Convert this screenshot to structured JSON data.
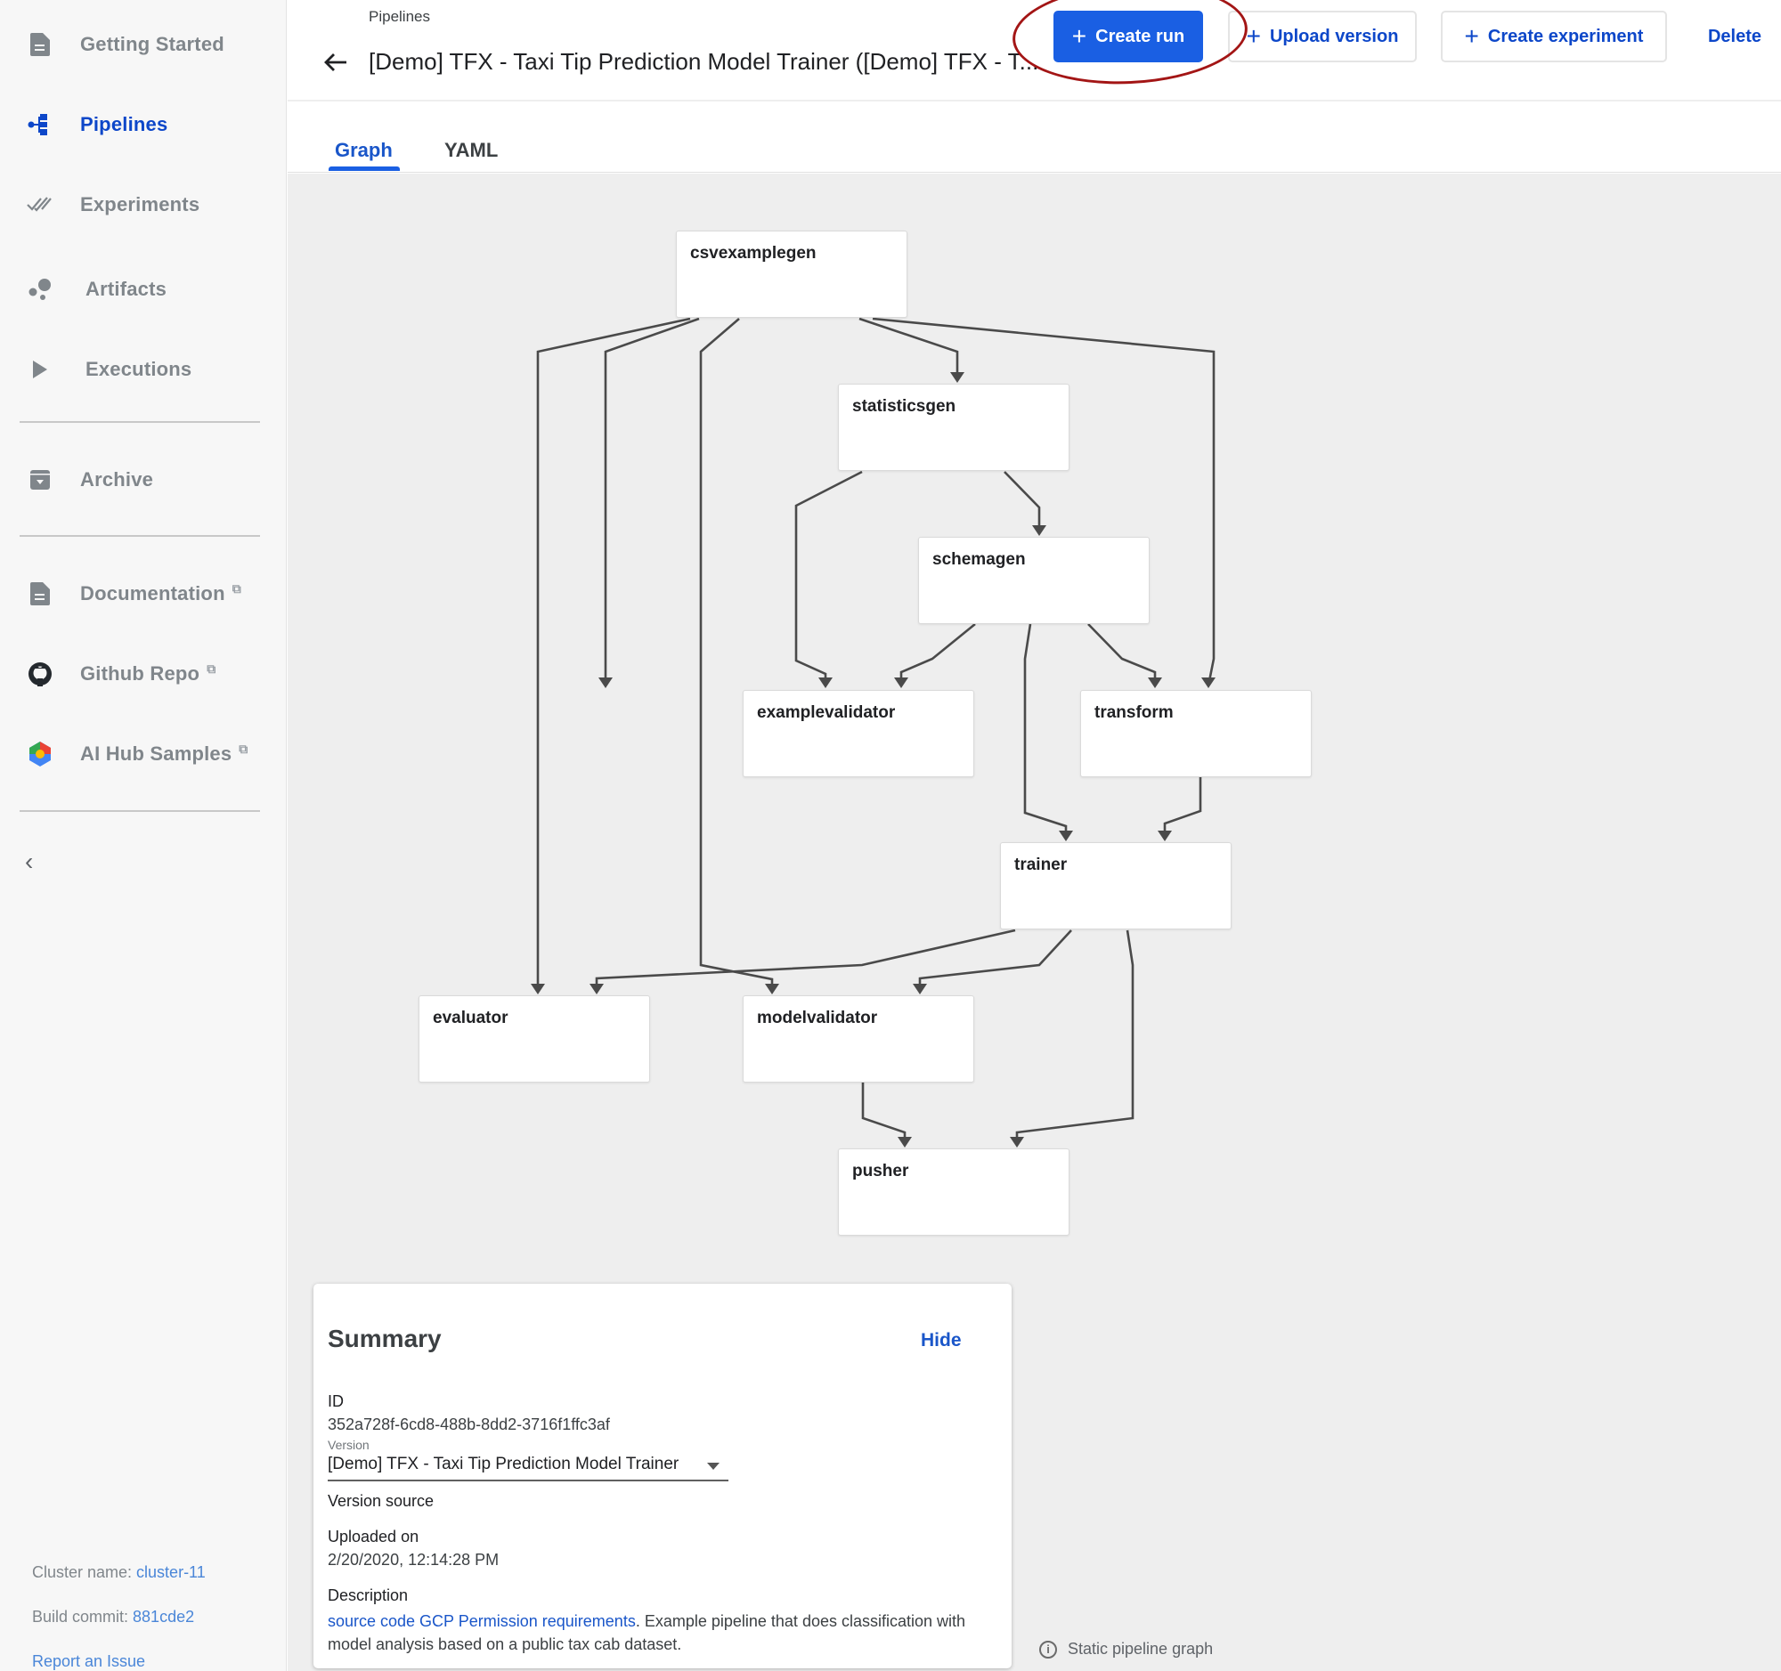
{
  "sidebar": {
    "items": [
      {
        "label": "Getting Started",
        "icon": "document-icon",
        "active": false,
        "external": false
      },
      {
        "label": "Pipelines",
        "icon": "pipeline-icon",
        "active": true,
        "external": false
      },
      {
        "label": "Experiments",
        "icon": "double-check-icon",
        "active": false,
        "external": false
      },
      {
        "label": "Artifacts",
        "icon": "bubbles-icon",
        "active": false,
        "external": false
      },
      {
        "label": "Executions",
        "icon": "play-icon",
        "active": false,
        "external": false
      },
      {
        "label": "Archive",
        "icon": "archive-icon",
        "active": false,
        "external": false
      },
      {
        "label": "Documentation",
        "icon": "document-icon",
        "active": false,
        "external": true
      },
      {
        "label": "Github Repo",
        "icon": "github-icon",
        "active": false,
        "external": true
      },
      {
        "label": "AI Hub Samples",
        "icon": "ai-hub-icon",
        "active": false,
        "external": true
      }
    ],
    "external_glyph": "⧉",
    "collapse_glyph": "‹",
    "footer": {
      "cluster_label": "Cluster name: ",
      "cluster_value": "cluster-11",
      "commit_label": "Build commit: ",
      "commit_value": "881cde2",
      "report_issue": "Report an Issue"
    }
  },
  "header": {
    "breadcrumb": "Pipelines",
    "title": "[Demo] TFX - Taxi Tip Prediction Model Trainer ([Demo] TFX - T...",
    "buttons": {
      "create_run": "Create run",
      "upload_version": "Upload version",
      "create_experiment": "Create experiment",
      "delete": "Delete"
    },
    "plus_glyph": "+"
  },
  "tabs": [
    {
      "label": "Graph",
      "active": true
    },
    {
      "label": "YAML",
      "active": false
    }
  ],
  "graph": {
    "nodes": [
      {
        "id": "csvexamplegen",
        "label": "csvexamplegen"
      },
      {
        "id": "statisticsgen",
        "label": "statisticsgen"
      },
      {
        "id": "schemagen",
        "label": "schemagen"
      },
      {
        "id": "examplevalidator",
        "label": "examplevalidator"
      },
      {
        "id": "transform",
        "label": "transform"
      },
      {
        "id": "trainer",
        "label": "trainer"
      },
      {
        "id": "evaluator",
        "label": "evaluator"
      },
      {
        "id": "modelvalidator",
        "label": "modelvalidator"
      },
      {
        "id": "pusher",
        "label": "pusher"
      }
    ],
    "edges": [
      [
        "csvexamplegen",
        "statisticsgen"
      ],
      [
        "csvexamplegen",
        "examplevalidator"
      ],
      [
        "csvexamplegen",
        "transform"
      ],
      [
        "csvexamplegen",
        "evaluator"
      ],
      [
        "csvexamplegen",
        "modelvalidator"
      ],
      [
        "statisticsgen",
        "schemagen"
      ],
      [
        "statisticsgen",
        "examplevalidator"
      ],
      [
        "schemagen",
        "examplevalidator"
      ],
      [
        "schemagen",
        "transform"
      ],
      [
        "schemagen",
        "trainer"
      ],
      [
        "transform",
        "trainer"
      ],
      [
        "trainer",
        "evaluator"
      ],
      [
        "trainer",
        "modelvalidator"
      ],
      [
        "trainer",
        "pusher"
      ],
      [
        "modelvalidator",
        "pusher"
      ]
    ],
    "static_note": "Static pipeline graph",
    "edge_color": "#4a4a4a"
  },
  "summary": {
    "title": "Summary",
    "hide": "Hide",
    "id_label": "ID",
    "id_value": "352a728f-6cd8-488b-8dd2-3716f1ffc3af",
    "version_label": "Version",
    "version_value": "[Demo] TFX - Taxi Tip Prediction Model Trainer",
    "version_source_label": "Version source",
    "uploaded_label": "Uploaded on",
    "uploaded_value": "2/20/2020, 12:14:28 PM",
    "description_label": "Description",
    "description_link": "source code GCP Permission requirements",
    "description_text": ". Example pipeline that does classification with model analysis based on a public tax cab dataset."
  },
  "colors": {
    "accent": "#1a5fe3",
    "link": "#1a56c9",
    "annotation": "#a31515"
  }
}
